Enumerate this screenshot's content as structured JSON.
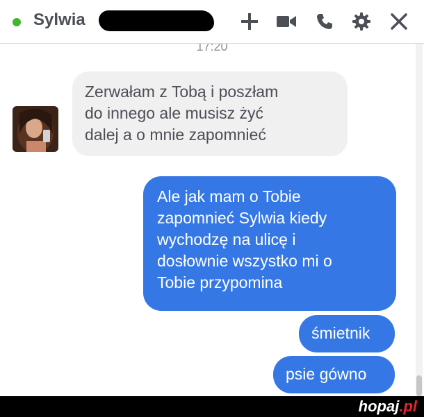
{
  "header": {
    "contact_name": "Sylwia",
    "status_color": "#42b72a",
    "icons": [
      "plus-icon",
      "video-camera-icon",
      "phone-icon",
      "gear-icon",
      "close-icon"
    ]
  },
  "chat": {
    "timestamp": "17:20",
    "received": [
      {
        "text": "Zerwałam z Tobą i poszłam\ndo innego ale musisz żyć\ndalej a o mnie zapomnieć"
      }
    ],
    "sent": [
      {
        "text": "Ale jak mam o Tobie\nzapomnieć Sylwia kiedy\nwychodzę na ulicę i\ndosłownie wszystko mi o\nTobie przypomina"
      },
      {
        "text": "śmietnik"
      },
      {
        "text": "psie gówno"
      }
    ],
    "sent_color": "#3578e5",
    "received_color": "#f1f0f0"
  },
  "footer": {
    "brand_name": "hopaj",
    "brand_tld": ".pl"
  }
}
